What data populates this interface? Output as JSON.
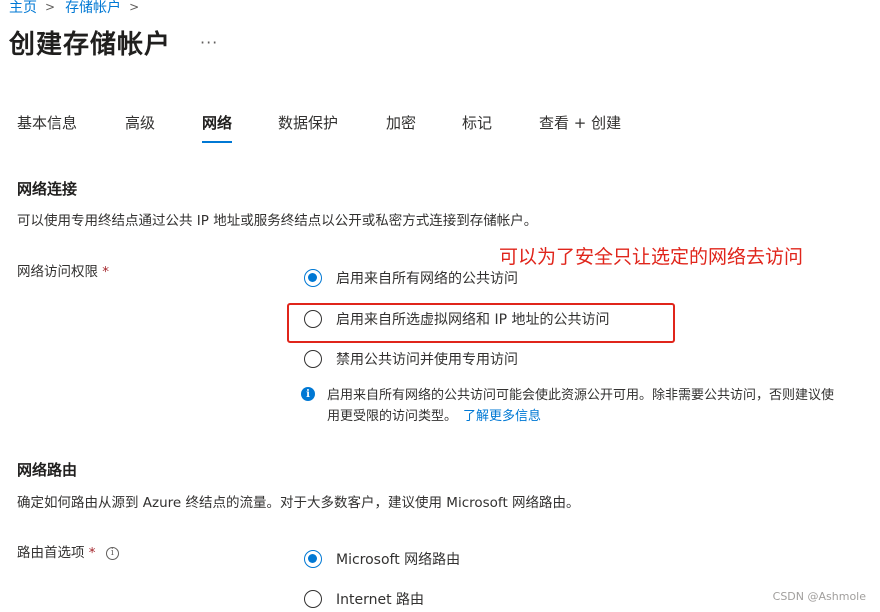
{
  "breadcrumb": {
    "home": "主页",
    "storage_accounts": "存储帐户",
    "separator": ">"
  },
  "page": {
    "title": "创建存储帐户",
    "more": "···"
  },
  "tabs": [
    {
      "label": "基本信息"
    },
    {
      "label": "高级"
    },
    {
      "label": "网络",
      "active": true
    },
    {
      "label": "数据保护"
    },
    {
      "label": "加密"
    },
    {
      "label": "标记"
    },
    {
      "label": "查看 + 创建"
    }
  ],
  "network_connectivity": {
    "title": "网络连接",
    "description": "可以使用专用终结点通过公共 IP 地址或服务终结点以公开或私密方式连接到存储帐户。",
    "access_label": "网络访问权限",
    "required_mark": "*",
    "options": [
      {
        "label": "启用来自所有网络的公共访问",
        "checked": true
      },
      {
        "label": "启用来自所选虚拟网络和 IP 地址的公共访问",
        "checked": false
      },
      {
        "label": "禁用公共访问并使用专用访问",
        "checked": false
      }
    ],
    "info_text": "启用来自所有网络的公共访问可能会使此资源公开可用。除非需要公共访问，否则建议使用更受限的访问类型。",
    "info_link": "了解更多信息"
  },
  "annotation": {
    "text": "可以为了安全只让选定的网络去访问",
    "color": "#e0251b"
  },
  "network_routing": {
    "title": "网络路由",
    "description": "确定如何路由从源到 Azure 终结点的流量。对于大多数客户，建议使用 Microsoft 网络路由。",
    "preference_label": "路由首选项",
    "required_mark": "*",
    "options": [
      {
        "label": "Microsoft 网络路由",
        "checked": true
      },
      {
        "label": "Internet 路由",
        "checked": false
      }
    ]
  },
  "watermark": "CSDN @Ashmole",
  "colors": {
    "accent": "#0078d4",
    "annotation": "#e0251b",
    "text": "#323130"
  }
}
